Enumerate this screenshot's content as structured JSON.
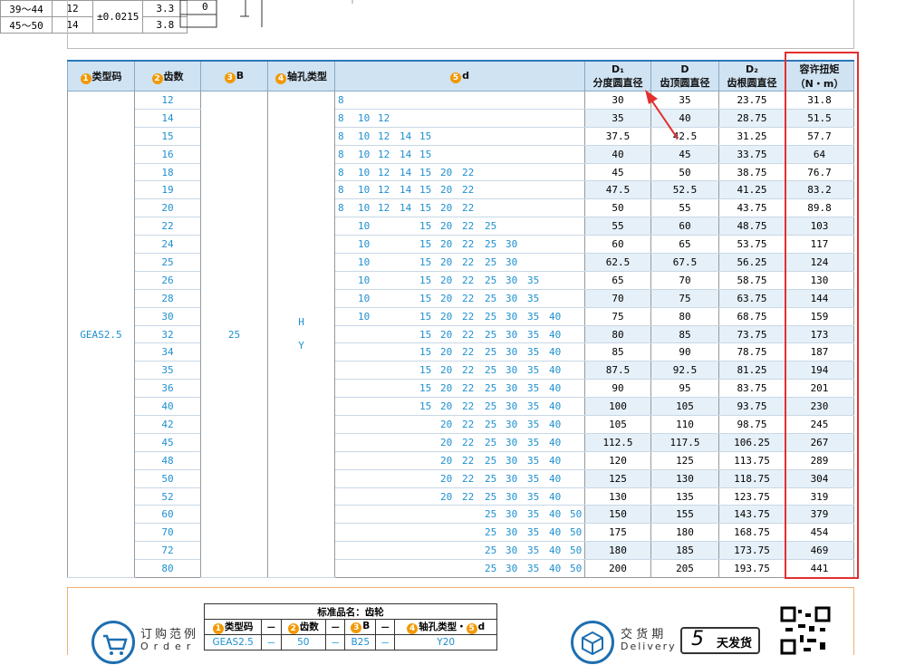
{
  "tolerance": {
    "rows": [
      [
        "39～44",
        "12"
      ],
      [
        "45～50",
        "14"
      ]
    ],
    "tol": "±0.0215",
    "vals": [
      "3.3",
      "3.8"
    ],
    "zero": "0"
  },
  "headers": {
    "type": "类型码",
    "type_num": "1",
    "teeth": "齿数",
    "teeth_num": "2",
    "b": "B",
    "b_num": "3",
    "hole": "轴孔类型",
    "hole_num": "4",
    "d": "d",
    "d_num": "5",
    "d1_top": "D₁",
    "d1_bot": "分度圆直径",
    "D_top": "D",
    "D_bot": "齿顶圆直径",
    "d2_top": "D₂",
    "d2_bot": "齿根圆直径",
    "torque_top": "容许扭矩",
    "torque_bot": "（N・m）"
  },
  "type_code": "GEAS2.5",
  "b_value": "25",
  "hole_types": [
    "H",
    "Y"
  ],
  "d_columns": [
    "8",
    "10",
    "12",
    "14",
    "15",
    "20",
    "22",
    "25",
    "30",
    "35",
    "40",
    "50"
  ],
  "rows": [
    {
      "z": "12",
      "d": [
        "8"
      ],
      "d1": "30",
      "D": "35",
      "d2": "23.75",
      "t": "31.8"
    },
    {
      "z": "14",
      "d": [
        "8",
        "10",
        "12"
      ],
      "d1": "35",
      "D": "40",
      "d2": "28.75",
      "t": "51.5"
    },
    {
      "z": "15",
      "d": [
        "8",
        "10",
        "12",
        "14",
        "15"
      ],
      "d1": "37.5",
      "D": "42.5",
      "d2": "31.25",
      "t": "57.7"
    },
    {
      "z": "16",
      "d": [
        "8",
        "10",
        "12",
        "14",
        "15"
      ],
      "d1": "40",
      "D": "45",
      "d2": "33.75",
      "t": "64"
    },
    {
      "z": "18",
      "d": [
        "8",
        "10",
        "12",
        "14",
        "15",
        "20",
        "22"
      ],
      "d1": "45",
      "D": "50",
      "d2": "38.75",
      "t": "76.7"
    },
    {
      "z": "19",
      "d": [
        "8",
        "10",
        "12",
        "14",
        "15",
        "20",
        "22"
      ],
      "d1": "47.5",
      "D": "52.5",
      "d2": "41.25",
      "t": "83.2"
    },
    {
      "z": "20",
      "d": [
        "8",
        "10",
        "12",
        "14",
        "15",
        "20",
        "22"
      ],
      "d1": "50",
      "D": "55",
      "d2": "43.75",
      "t": "89.8"
    },
    {
      "z": "22",
      "d": [
        "10",
        "15",
        "20",
        "22",
        "25"
      ],
      "d1": "55",
      "D": "60",
      "d2": "48.75",
      "t": "103"
    },
    {
      "z": "24",
      "d": [
        "10",
        "15",
        "20",
        "22",
        "25",
        "30"
      ],
      "d1": "60",
      "D": "65",
      "d2": "53.75",
      "t": "117"
    },
    {
      "z": "25",
      "d": [
        "10",
        "15",
        "20",
        "22",
        "25",
        "30"
      ],
      "d1": "62.5",
      "D": "67.5",
      "d2": "56.25",
      "t": "124"
    },
    {
      "z": "26",
      "d": [
        "10",
        "15",
        "20",
        "22",
        "25",
        "30",
        "35"
      ],
      "d1": "65",
      "D": "70",
      "d2": "58.75",
      "t": "130"
    },
    {
      "z": "28",
      "d": [
        "10",
        "15",
        "20",
        "22",
        "25",
        "30",
        "35"
      ],
      "d1": "70",
      "D": "75",
      "d2": "63.75",
      "t": "144"
    },
    {
      "z": "30",
      "d": [
        "10",
        "15",
        "20",
        "22",
        "25",
        "30",
        "35",
        "40"
      ],
      "d1": "75",
      "D": "80",
      "d2": "68.75",
      "t": "159"
    },
    {
      "z": "32",
      "d": [
        "15",
        "20",
        "22",
        "25",
        "30",
        "35",
        "40"
      ],
      "d1": "80",
      "D": "85",
      "d2": "73.75",
      "t": "173"
    },
    {
      "z": "34",
      "d": [
        "15",
        "20",
        "22",
        "25",
        "30",
        "35",
        "40"
      ],
      "d1": "85",
      "D": "90",
      "d2": "78.75",
      "t": "187"
    },
    {
      "z": "35",
      "d": [
        "15",
        "20",
        "22",
        "25",
        "30",
        "35",
        "40"
      ],
      "d1": "87.5",
      "D": "92.5",
      "d2": "81.25",
      "t": "194"
    },
    {
      "z": "36",
      "d": [
        "15",
        "20",
        "22",
        "25",
        "30",
        "35",
        "40"
      ],
      "d1": "90",
      "D": "95",
      "d2": "83.75",
      "t": "201"
    },
    {
      "z": "40",
      "d": [
        "15",
        "20",
        "22",
        "25",
        "30",
        "35",
        "40"
      ],
      "d1": "100",
      "D": "105",
      "d2": "93.75",
      "t": "230"
    },
    {
      "z": "42",
      "d": [
        "20",
        "22",
        "25",
        "30",
        "35",
        "40"
      ],
      "d1": "105",
      "D": "110",
      "d2": "98.75",
      "t": "245"
    },
    {
      "z": "45",
      "d": [
        "20",
        "22",
        "25",
        "30",
        "35",
        "40"
      ],
      "d1": "112.5",
      "D": "117.5",
      "d2": "106.25",
      "t": "267"
    },
    {
      "z": "48",
      "d": [
        "20",
        "22",
        "25",
        "30",
        "35",
        "40"
      ],
      "d1": "120",
      "D": "125",
      "d2": "113.75",
      "t": "289"
    },
    {
      "z": "50",
      "d": [
        "20",
        "22",
        "25",
        "30",
        "35",
        "40"
      ],
      "d1": "125",
      "D": "130",
      "d2": "118.75",
      "t": "304"
    },
    {
      "z": "52",
      "d": [
        "20",
        "22",
        "25",
        "30",
        "35",
        "40"
      ],
      "d1": "130",
      "D": "135",
      "d2": "123.75",
      "t": "319"
    },
    {
      "z": "60",
      "d": [
        "25",
        "30",
        "35",
        "40",
        "50"
      ],
      "d1": "150",
      "D": "155",
      "d2": "143.75",
      "t": "379"
    },
    {
      "z": "70",
      "d": [
        "25",
        "30",
        "35",
        "40",
        "50"
      ],
      "d1": "175",
      "D": "180",
      "d2": "168.75",
      "t": "454"
    },
    {
      "z": "72",
      "d": [
        "25",
        "30",
        "35",
        "40",
        "50"
      ],
      "d1": "180",
      "D": "185",
      "d2": "173.75",
      "t": "469"
    },
    {
      "z": "80",
      "d": [
        "25",
        "30",
        "35",
        "40",
        "50"
      ],
      "d1": "200",
      "D": "205",
      "d2": "193.75",
      "t": "441"
    }
  ],
  "order": {
    "label_cn": "订购范例",
    "label_en": "Order",
    "std_name": "标准品名：齿轮",
    "cols": [
      "类型码",
      "齿数",
      "B",
      "轴孔类型・",
      "d"
    ],
    "vals": [
      "GEAS2.5",
      "50",
      "B25",
      "Y20"
    ],
    "dash": "－"
  },
  "delivery": {
    "label_cn": "交 货 期",
    "label_en": "Delivery",
    "days": "5",
    "unit": "天发货"
  }
}
